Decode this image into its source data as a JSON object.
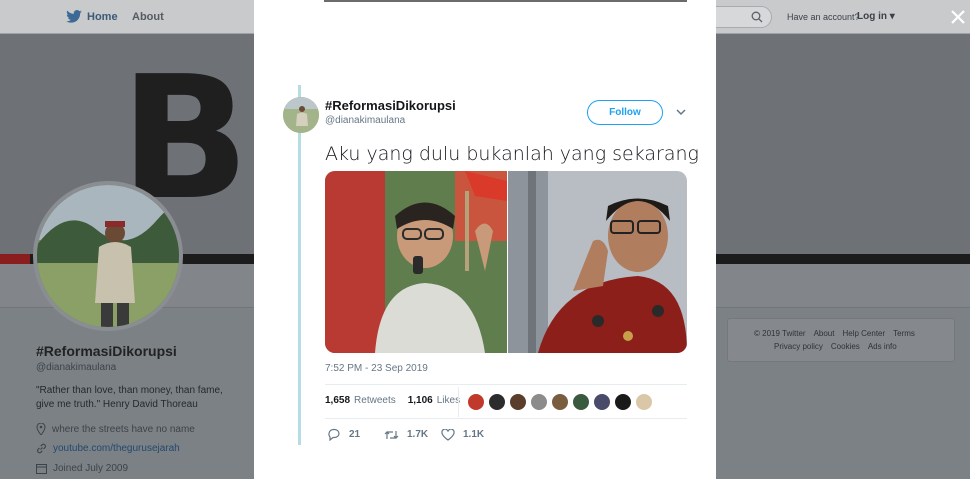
{
  "topbar": {
    "home_label": "Home",
    "about_label": "About",
    "have_account": "Have an account?",
    "login_label": "Log in ▾"
  },
  "banner": {
    "text": "B     D."
  },
  "profile": {
    "name": "#ReformasiDikorupsi",
    "handle": "@dianakimaulana",
    "bio": "\"Rather than love, than money, than fame, give me truth.\" Henry David Thoreau",
    "location": "where the streets have no name",
    "website": "youtube.com/thegurusejarah",
    "joined": "Joined July 2009"
  },
  "footer": {
    "line1": [
      "© 2019 Twitter",
      "About",
      "Help Center",
      "Terms"
    ],
    "line2": [
      "Privacy policy",
      "Cookies",
      "Ads info"
    ]
  },
  "tweet": {
    "name": "#ReformasiDikorupsi",
    "handle": "@dianakimaulana",
    "follow_label": "Follow",
    "text": "Aku yang dulu bukanlah yang sekarang",
    "timestamp": "7:52 PM - 23 Sep 2019",
    "retweets_count": "1,658",
    "retweets_label": "Retweets",
    "likes_count": "1,106",
    "likes_label": "Likes",
    "replies": "21",
    "retweets_short": "1.7K",
    "likes_short": "1.1K",
    "liker_colors": [
      "#c0392b",
      "#2c2c2c",
      "#5a3d2b",
      "#8c8c8c",
      "#7a5c3e",
      "#3a5a40",
      "#4a4a6a",
      "#1a1a1a",
      "#d9c7a8"
    ]
  },
  "colors": {
    "accent": "#1da1f2",
    "thread_line": "#b4dde4"
  }
}
